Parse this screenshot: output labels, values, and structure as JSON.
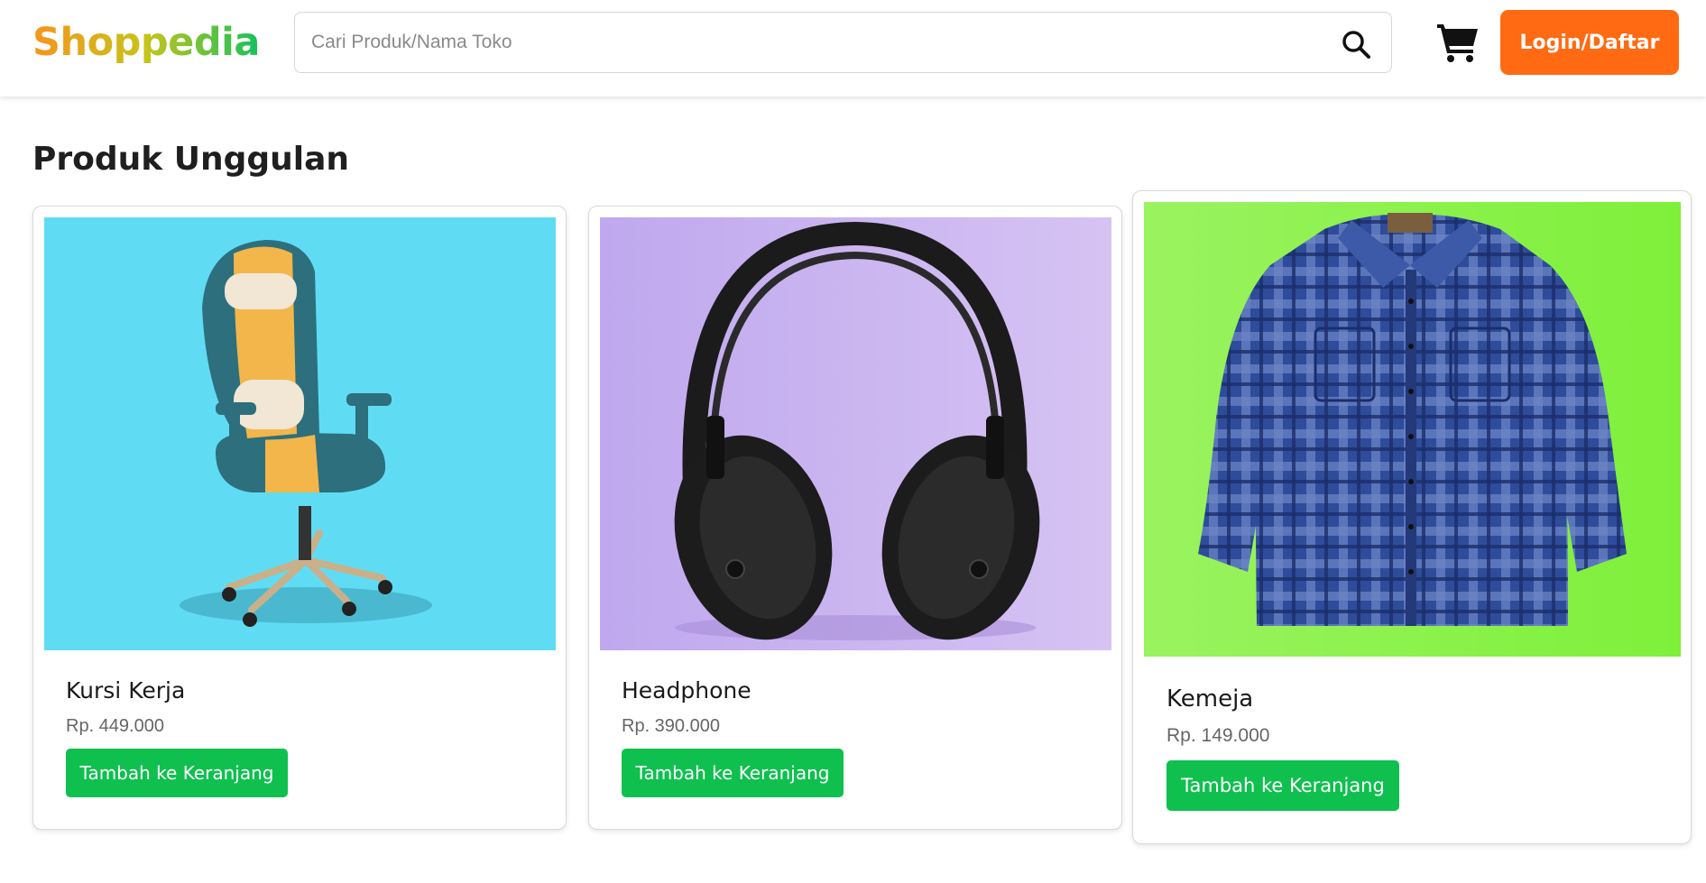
{
  "header": {
    "logo": "Shoppedia",
    "search_placeholder": "Cari Produk/Nama Toko",
    "search_value": "",
    "login_label": "Login/Daftar",
    "icons": [
      "search-icon",
      "cart-icon"
    ]
  },
  "section": {
    "title": "Produk Unggulan"
  },
  "products": [
    {
      "name": "Kursi Kerja",
      "price": "Rp. 449.000",
      "button": "Tambah ke Keranjang",
      "image": "office-chair",
      "image_bg": "#5fdcf4"
    },
    {
      "name": "Headphone",
      "price": "Rp. 390.000",
      "button": "Tambah ke Keranjang",
      "image": "headphones",
      "image_bg": "#c9b4f1"
    },
    {
      "name": "Kemeja",
      "price": "Rp. 149.000",
      "button": "Tambah ke Keranjang",
      "image": "plaid-shirt",
      "image_bg": "#8cf04b"
    }
  ],
  "colors": {
    "accent_orange": "#ff6a13",
    "accent_green": "#0fc04f"
  }
}
